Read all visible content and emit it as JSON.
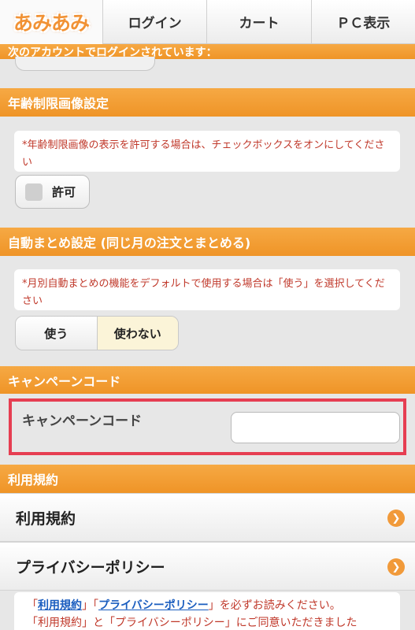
{
  "nav": {
    "logo": "あみあみ",
    "login": "ログイン",
    "cart": "カート",
    "pc": "ＰＣ表示"
  },
  "account_bar": "次のアカウントでログインされています：",
  "age": {
    "header": "年齢制限画像設定",
    "note": "*年齢制限画像の表示を許可する場合は、チェックボックスをオンにしてください",
    "checkbox_label": "許可"
  },
  "auto": {
    "header": "自動まとめ設定 (同じ月の注文とまとめる)",
    "note": "*月別自動まとめの機能をデフォルトで使用する場合は「使う」を選択してください",
    "use": "使う",
    "not_use": "使わない"
  },
  "campaign": {
    "header": "キャンペーンコード",
    "label": "キャンペーンコード",
    "value": ""
  },
  "terms": {
    "header": "利用規約",
    "terms_row": "利用規約",
    "privacy_row": "プライバシーポリシー"
  },
  "notice": {
    "q1": "「",
    "link1": "利用規約",
    "q2": "」「",
    "link2": "プライバシーポリシー",
    "tail1": "」を必ずお読みください。",
    "line2": "「利用規約」と「プライバシーポリシー」にご同意いただきました"
  },
  "colors": {
    "accent": "#f19a3a",
    "highlight": "#e63e52"
  }
}
